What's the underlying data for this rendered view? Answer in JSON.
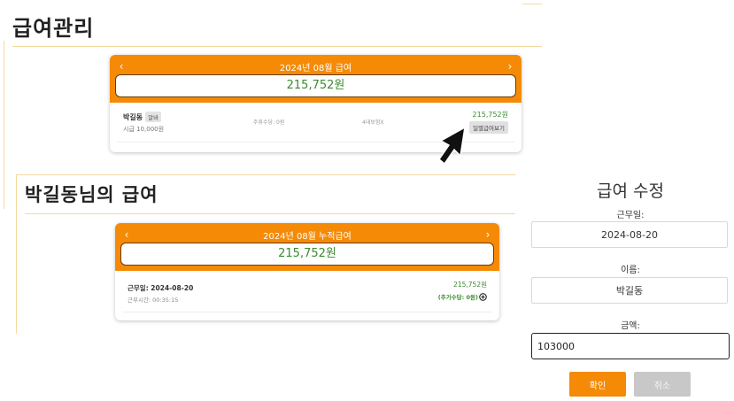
{
  "main": {
    "title": "급여관리",
    "card": {
      "header_title": "2024년 08월 급여",
      "prev_arrow": "‹",
      "next_arrow": "›",
      "total": "215,752원",
      "row": {
        "name": "박길동",
        "badge": "알바",
        "hourly": "시급 10,000원",
        "extra_pay": "주휴수당: 0원",
        "insurance": "4대보험X",
        "amount": "215,752원",
        "detail_button": "일별급여보기"
      }
    }
  },
  "detail": {
    "title": "박길동님의 급여",
    "card": {
      "header_title": "2024년 08월 누적급여",
      "prev_arrow": "‹",
      "next_arrow": "›",
      "total": "215,752원",
      "row": {
        "work_date": "근무일: 2024-08-20",
        "work_time": "근무시간: 00:35:15",
        "amount": "215,752원",
        "extra": "(추가수당: 0원)"
      }
    }
  },
  "edit_form": {
    "title": "급여 수정",
    "date_label": "근무일:",
    "date_value": "2024-08-20",
    "name_label": "이름:",
    "name_value": "박길동",
    "amount_label": "금액:",
    "amount_value": "103000",
    "ok_button": "확인",
    "cancel_button": "취소"
  },
  "colors": {
    "accent": "#f58a07",
    "money_green": "#3a8b2e",
    "divider": "#f3d9a0"
  },
  "icons": {
    "cursor": "arrow-cursor-icon",
    "add": "plus-circle-icon"
  }
}
